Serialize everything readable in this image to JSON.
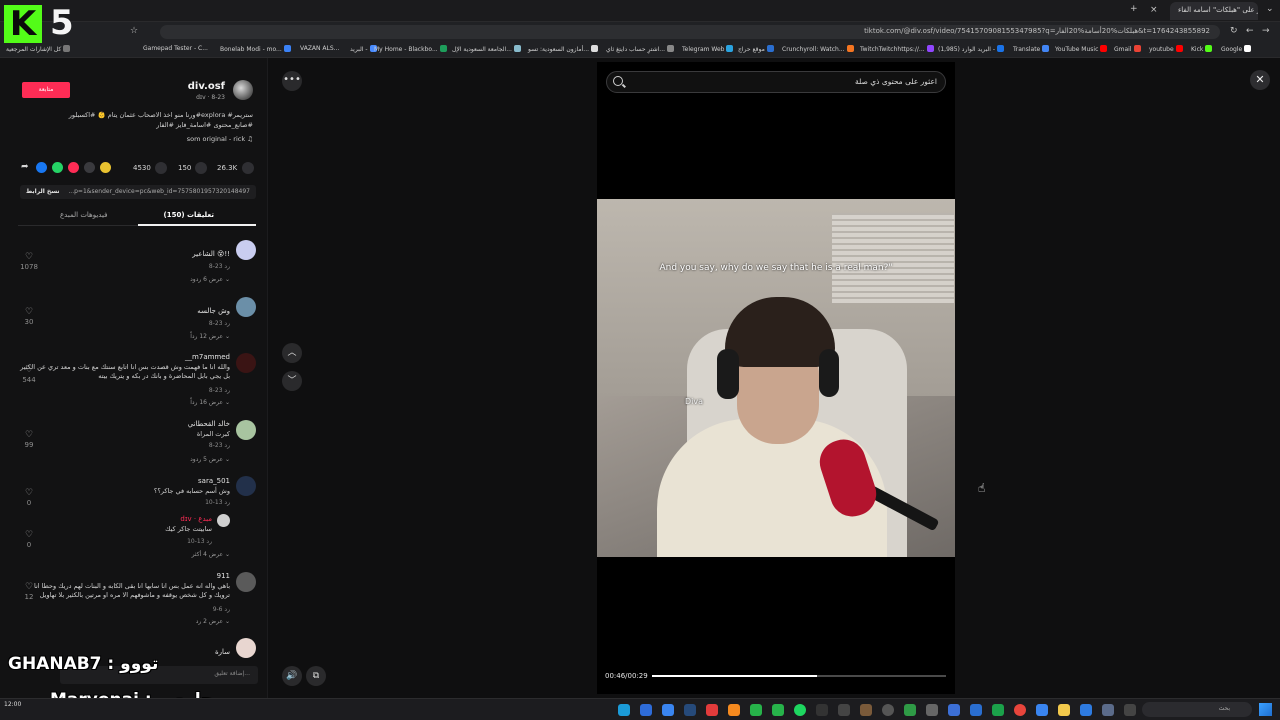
{
  "browser": {
    "tab_title": "انظر على \"هبلكات\" اسامه الفاء",
    "url": "tiktok.com/@div.osf/video/7541570908155347985?q=هبلكات%20أسامة%20الفار&t=1764243855892",
    "bookmarks": [
      "كل الإشارات المرجعية",
      "Gamepad Tester - C...",
      "Bonelab Modi - mo...",
      "VAZAN ALS...",
      "البريد -",
      "My Home - Blackbo...",
      "الجامعة السعودية الإل...",
      "أمازون السعودية: تسو...",
      "اشترِ حساب دايتغ ثاي...",
      "Telegram Web",
      "موقع حراج",
      "Crunchyroll: Watch...",
      "TwitchTwitchhttps://...",
      "(1,985) البريد الوارد -",
      "Translate",
      "YouTube Music",
      "Gmail",
      "youtube",
      "Kick",
      "Google"
    ]
  },
  "post": {
    "follow_label": "متابعة",
    "author": "div.osf",
    "author_sub": "dɪv · 8-23",
    "description": "ورنا منو اخذ الاصحاب عثمان يتام 👶 #اكسبلور#explora #ستريمر #صانع_محتوى #اسامة_فايز #الفار",
    "music": "som original - rick",
    "likes": "26.3K",
    "comments": "150",
    "saves": "4530",
    "link": "...p=1&sender_device=pc&web_id=7575801957320148497",
    "copy_link": "نسخ الرابط"
  },
  "tabs": {
    "comments_tab": "تعليقات (150)",
    "creator_tab": "فيديوهات المبدع"
  },
  "comments": [
    {
      "name": "الشاعير 😵!!",
      "text": "",
      "meta": "8-23   رد",
      "reply": "عرض 6 ردود",
      "likes": "1078"
    },
    {
      "name": "وش جالسه",
      "text": "",
      "meta": "8-23   رد",
      "reply": "عرض 12 رداً",
      "likes": "30"
    },
    {
      "name": "__m7ammed",
      "text": "والله انا ما فهمت وش قصدت بس انا اتابع سنتك مع بنات و معد تري عن الكثير بل يجي بابل المحاضرة و بانك در بكه و يتريك بيته",
      "meta": "8-23   رد",
      "reply": "عرض 16 رداً",
      "likes": "544"
    },
    {
      "name": "خالد القحطاني",
      "text": "كبرت المراة",
      "meta": "8-23   رد",
      "reply": "عرض 5 ردود",
      "likes": "99"
    },
    {
      "name": "sara_501",
      "text": "وش أسم حسابه في جاكر؟؟",
      "meta": "10-13   رد",
      "reply": "",
      "likes": "0"
    },
    {
      "name": "dɪv · مبدع",
      "text": "سابيتت جاكر كيك",
      "meta": "10-13   رد",
      "reply": "عرض 4 أكثر",
      "likes": "0"
    },
    {
      "name": "911",
      "text": "باهي واله انه عمل بس انا سابها انا بقى الكابه و البنات لهم دريك وحطا انا ترويك و كل شخص يوقفه و ماشوفهم الا مره او مرتين بالكثير بلا تهاويل",
      "meta": "9-6   رد",
      "reply": "عرض 2 رد",
      "likes": "12"
    },
    {
      "name": "سارة",
      "text": "",
      "meta": "",
      "reply": "",
      "likes": ""
    }
  ],
  "add_comment_placeholder": "إضافة تعليق...",
  "search": {
    "text": "اعثور على محتوى ذي صلة"
  },
  "video": {
    "caption": "And you say, why do we say that he is a real man?\"",
    "watermark": "Diva",
    "time": "00:46/00:29",
    "progress": 0.56
  },
  "stream_overlay": {
    "chat1_user": "GHANAB7",
    "chat1_msg": "تووو",
    "chat2_user": "Maryonai",
    "chat2_msg": "جامعي",
    "logo_letter": "K",
    "logo_number": "5"
  },
  "taskbar": {
    "search_label": "بحث",
    "clock": "12:00"
  },
  "colors": {
    "accent": "#fe2c55",
    "kick": "#53fc18"
  }
}
